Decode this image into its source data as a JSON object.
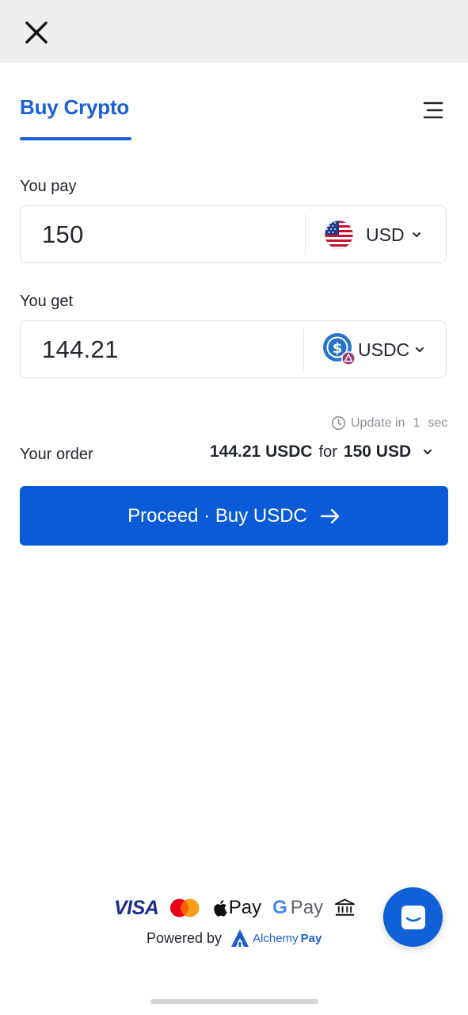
{
  "header": {
    "close_icon": "close-icon"
  },
  "tabs": {
    "active_label": "Buy Crypto",
    "menu_icon": "menu-icon"
  },
  "pay": {
    "label": "You pay",
    "value": "150",
    "currency": "USD",
    "flag_icon": "us-flag-icon"
  },
  "get": {
    "label": "You get",
    "value": "144.21",
    "currency": "USDC",
    "token_icon": "usdc-icon"
  },
  "update": {
    "prefix": "Update in",
    "count": "1",
    "unit": "sec"
  },
  "order": {
    "label": "Your order",
    "amount_crypto": "144.21 USDC",
    "for_word": "for",
    "amount_fiat": "150 USD"
  },
  "proceed": {
    "label": "Proceed · Buy USDC"
  },
  "footer": {
    "visa": "VISA",
    "apple_pay": "Pay",
    "google_g": "G",
    "google_pay": "Pay",
    "powered_by": "Powered by",
    "brand_name": "Alchemy",
    "brand_pay": "Pay"
  },
  "colors": {
    "accent": "#0b5bd8",
    "tab_text": "#1a5fd6",
    "muted_text": "#8a8f98"
  }
}
